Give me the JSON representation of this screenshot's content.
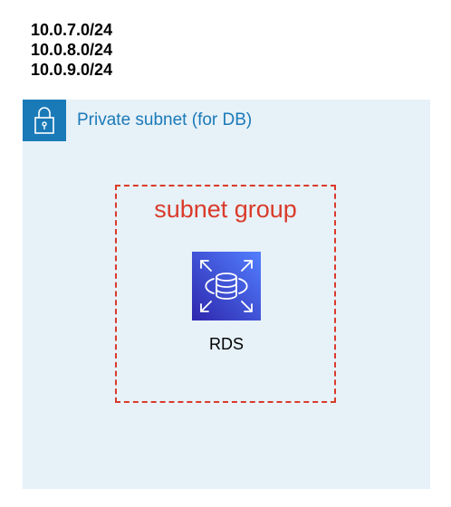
{
  "cidr_blocks": [
    "10.0.7.0/24",
    "10.0.8.0/24",
    "10.0.9.0/24"
  ],
  "private_subnet": {
    "label": "Private subnet (for DB)",
    "icon": "lock-icon",
    "color": "#1a7ab8",
    "fill": "#e7f1f8"
  },
  "subnet_group": {
    "label": "subnet group",
    "border_color": "#d93b2b"
  },
  "rds": {
    "label": "RDS",
    "icon": "rds-database-icon",
    "gradient": [
      "#2e27ad",
      "#527fff"
    ]
  }
}
